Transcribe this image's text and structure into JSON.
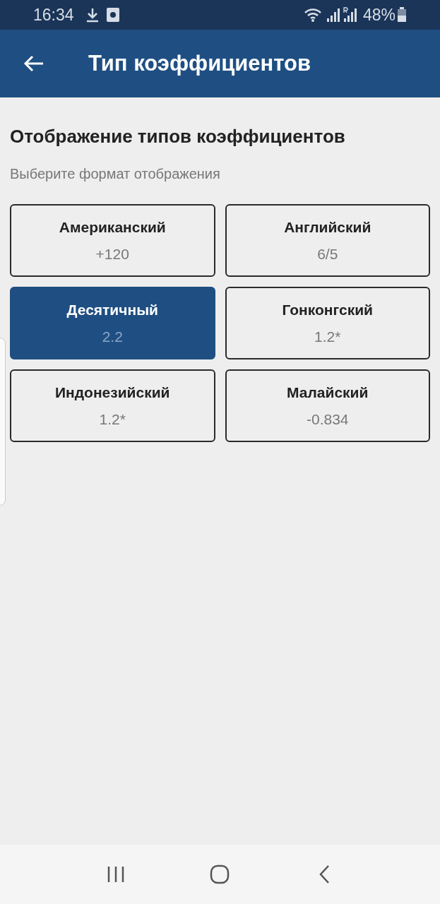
{
  "status_bar": {
    "time": "16:34",
    "battery": "48%"
  },
  "app_bar": {
    "title": "Тип коэффициентов"
  },
  "heading": "Отображение типов коэффициентов",
  "subtitle": "Выберите формат отображения",
  "options": [
    {
      "label": "Американский",
      "example": "+120",
      "selected": false
    },
    {
      "label": "Английский",
      "example": "6/5",
      "selected": false
    },
    {
      "label": "Десятичный",
      "example": "2.2",
      "selected": true
    },
    {
      "label": "Гонконгский",
      "example": "1.2*",
      "selected": false
    },
    {
      "label": "Индонезийский",
      "example": "1.2*",
      "selected": false
    },
    {
      "label": "Малайский",
      "example": "-0.834",
      "selected": false
    }
  ]
}
